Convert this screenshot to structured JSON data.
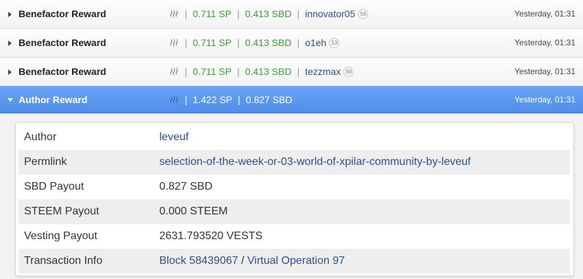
{
  "operations": [
    {
      "name": "Benefactor Reward",
      "sp": "0.711 SP",
      "sbd": "0.413 SBD",
      "account": "innovator05",
      "rep": "56",
      "time": "Yesterday, 01:31"
    },
    {
      "name": "Benefactor Reward",
      "sp": "0.711 SP",
      "sbd": "0.413 SBD",
      "account": "o1eh",
      "rep": "53",
      "time": "Yesterday, 01:31"
    },
    {
      "name": "Benefactor Reward",
      "sp": "0.711 SP",
      "sbd": "0.413 SBD",
      "account": "tezzmax",
      "rep": "68",
      "time": "Yesterday, 01:31"
    },
    {
      "name": "Author Reward",
      "sp": "1.422 SP",
      "sbd": "0.827 SBD",
      "time": "Yesterday, 01:31"
    }
  ],
  "details": {
    "author": {
      "key": "Author",
      "value": "leveuf"
    },
    "permlink": {
      "key": "Permlink",
      "value": "selection-of-the-week-or-03-world-of-xpilar-community-by-leveuf"
    },
    "sbd_payout": {
      "key": "SBD Payout",
      "value": "0.827 SBD"
    },
    "steem_payout": {
      "key": "STEEM Payout",
      "value": "0.000 STEEM"
    },
    "vesting_payout": {
      "key": "Vesting Payout",
      "value": "2631.793520 VESTS"
    },
    "tx_info": {
      "key": "Transaction Info",
      "block": "Block 58439067",
      "separator": "/",
      "virtual_op": "Virtual Operation 97"
    }
  },
  "colors": {
    "accent": "#4f8ee8",
    "amount": "#3a9e3a",
    "link": "#2d4f8e"
  },
  "icons": {
    "currency": "steem-logo-icon",
    "expand": "caret-right-icon",
    "collapse": "caret-down-icon"
  }
}
